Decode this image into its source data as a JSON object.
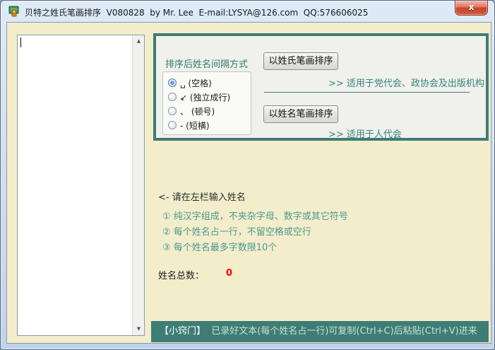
{
  "window": {
    "title": "贝特之姓氏笔画排序  V080828  by Mr. Lee  E-mail:LYSYA@126.com  QQ:576606025",
    "close_glyph": "x"
  },
  "colors": {
    "teal": "#3E7D75",
    "teal_text": "#35857A",
    "client_background": "#F3EDCC",
    "panel_background": "#F0F0EC",
    "count_red": "#FF0000"
  },
  "editor": {
    "value": ""
  },
  "panel": {
    "separator_label": "排序后姓名间隔方式",
    "options": [
      {
        "label": "␣ (空格)",
        "selected": true
      },
      {
        "label": "↙ (独立成行)",
        "selected": false
      },
      {
        "label": "、 (顿号)",
        "selected": false
      },
      {
        "label": "- (短横)",
        "selected": false
      }
    ],
    "sort_by_surname_button": "以姓氏笔画排序",
    "surname_hint": ">> 适用于党代会、政协会及出版机构",
    "sort_by_fullname_button": "以姓名笔画排序",
    "fullname_hint": ">> 适用于人代会"
  },
  "instructions": {
    "prompt": "<- 请在左栏输入姓名",
    "rules": [
      "① 纯汉字组成，不夹杂字母、数字或其它符号",
      "② 每个姓名占一行，不留空格或空行",
      "③ 每个姓名最多字数限10个"
    ],
    "total_label": "姓名总数：",
    "total_value": "0"
  },
  "footer": {
    "tip_label": "【小窍门】",
    "tip_text": "  已录好文本(每个姓名占一行)可复制(Ctrl+C)后粘贴(Ctrl+V)进来"
  },
  "scrollbar": {
    "up_glyph": "▲",
    "down_glyph": "▼"
  }
}
